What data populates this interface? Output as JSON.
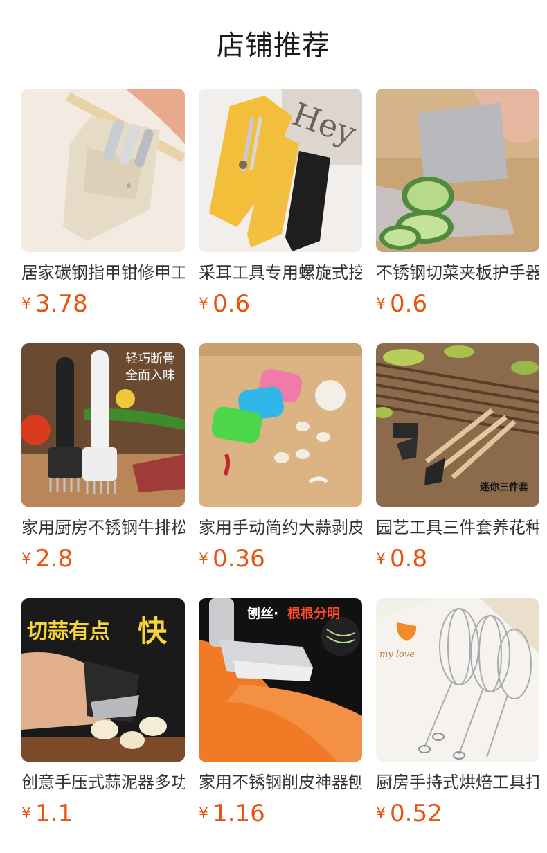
{
  "page": {
    "title": "店铺推荐"
  },
  "currency_symbol": "¥",
  "products": [
    {
      "name": "居家碳钢指甲钳修甲工具套装",
      "price": "3.78",
      "icon": "nail-clipper-set-image"
    },
    {
      "name": "采耳工具专用螺旋式挖耳勺套装",
      "price": "0.6",
      "icon": "ear-pick-set-image"
    },
    {
      "name": "不锈钢切菜夹板护手器",
      "price": "0.6",
      "icon": "finger-guard-image"
    },
    {
      "name": "家用厨房不锈钢牛排松肉针",
      "price": "2.8",
      "icon": "meat-tenderizer-image",
      "overlay": "轻巧断骨\n全面入味"
    },
    {
      "name": "家用手动简约大蒜剥皮器",
      "price": "0.36",
      "icon": "garlic-peeler-image"
    },
    {
      "name": "园艺工具三件套养花种菜",
      "price": "0.8",
      "icon": "garden-tools-image",
      "overlay": "迷你三件套"
    },
    {
      "name": "创意手压式蒜泥器多功能",
      "price": "1.1",
      "icon": "garlic-press-image",
      "overlay": "切蒜有点快"
    },
    {
      "name": "家用不锈钢削皮神器刨丝器",
      "price": "1.16",
      "icon": "peeler-image",
      "overlay": "刨丝·根根分明"
    },
    {
      "name": "厨房手持式烘焙工具打蛋器",
      "price": "0.52",
      "icon": "whisk-image",
      "overlay": "my love"
    }
  ]
}
